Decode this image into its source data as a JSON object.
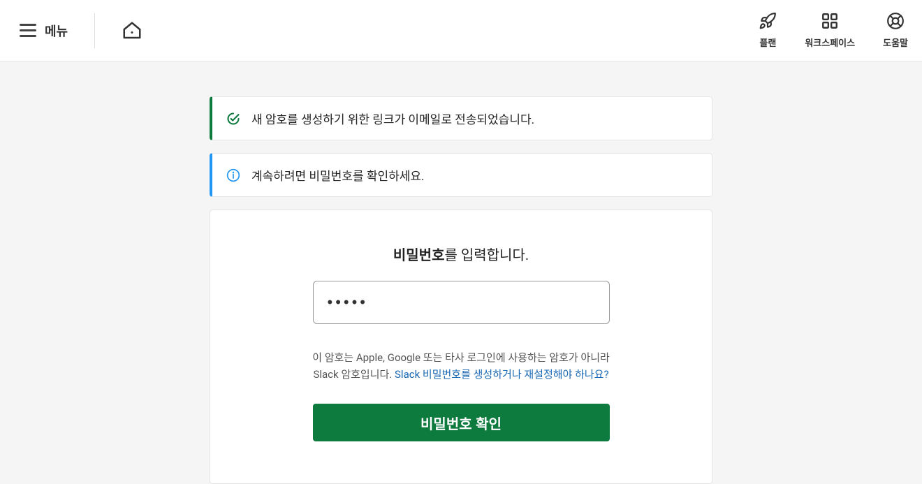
{
  "header": {
    "menu_label": "메뉴",
    "nav": {
      "plan": "플랜",
      "workspace": "워크스페이스",
      "help": "도움말"
    }
  },
  "alerts": {
    "success": "새 암호를 생성하기 위한 링크가 이메일로 전송되었습니다.",
    "info": "계속하려면 비밀번호를 확인하세요."
  },
  "card": {
    "title_bold": "비밀번호",
    "title_rest": "를 입력합니다.",
    "password_value": "•••••",
    "help_text_prefix": "이 암호는 Apple, Google 또는 타사 로그인에 사용하는 암호가 아니라 Slack 암호입니다. ",
    "help_link": "Slack 비밀번호를 생성하거나 재설정해야 하나요?",
    "confirm_button": "비밀번호 확인"
  },
  "colors": {
    "success": "#0d7a3e",
    "info": "#2196f3",
    "primary": "#0d7a3e"
  }
}
